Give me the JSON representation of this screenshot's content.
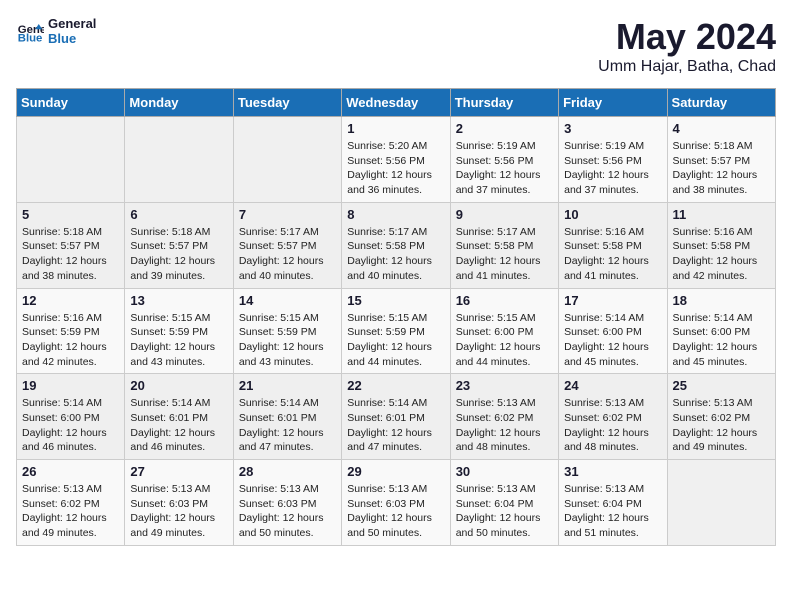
{
  "logo": {
    "text_general": "General",
    "text_blue": "Blue"
  },
  "title": "May 2024",
  "subtitle": "Umm Hajar, Batha, Chad",
  "weekdays": [
    "Sunday",
    "Monday",
    "Tuesday",
    "Wednesday",
    "Thursday",
    "Friday",
    "Saturday"
  ],
  "weeks": [
    [
      {
        "day": "",
        "sunrise": "",
        "sunset": "",
        "daylight": ""
      },
      {
        "day": "",
        "sunrise": "",
        "sunset": "",
        "daylight": ""
      },
      {
        "day": "",
        "sunrise": "",
        "sunset": "",
        "daylight": ""
      },
      {
        "day": "1",
        "sunrise": "Sunrise: 5:20 AM",
        "sunset": "Sunset: 5:56 PM",
        "daylight": "Daylight: 12 hours and 36 minutes."
      },
      {
        "day": "2",
        "sunrise": "Sunrise: 5:19 AM",
        "sunset": "Sunset: 5:56 PM",
        "daylight": "Daylight: 12 hours and 37 minutes."
      },
      {
        "day": "3",
        "sunrise": "Sunrise: 5:19 AM",
        "sunset": "Sunset: 5:56 PM",
        "daylight": "Daylight: 12 hours and 37 minutes."
      },
      {
        "day": "4",
        "sunrise": "Sunrise: 5:18 AM",
        "sunset": "Sunset: 5:57 PM",
        "daylight": "Daylight: 12 hours and 38 minutes."
      }
    ],
    [
      {
        "day": "5",
        "sunrise": "Sunrise: 5:18 AM",
        "sunset": "Sunset: 5:57 PM",
        "daylight": "Daylight: 12 hours and 38 minutes."
      },
      {
        "day": "6",
        "sunrise": "Sunrise: 5:18 AM",
        "sunset": "Sunset: 5:57 PM",
        "daylight": "Daylight: 12 hours and 39 minutes."
      },
      {
        "day": "7",
        "sunrise": "Sunrise: 5:17 AM",
        "sunset": "Sunset: 5:57 PM",
        "daylight": "Daylight: 12 hours and 40 minutes."
      },
      {
        "day": "8",
        "sunrise": "Sunrise: 5:17 AM",
        "sunset": "Sunset: 5:58 PM",
        "daylight": "Daylight: 12 hours and 40 minutes."
      },
      {
        "day": "9",
        "sunrise": "Sunrise: 5:17 AM",
        "sunset": "Sunset: 5:58 PM",
        "daylight": "Daylight: 12 hours and 41 minutes."
      },
      {
        "day": "10",
        "sunrise": "Sunrise: 5:16 AM",
        "sunset": "Sunset: 5:58 PM",
        "daylight": "Daylight: 12 hours and 41 minutes."
      },
      {
        "day": "11",
        "sunrise": "Sunrise: 5:16 AM",
        "sunset": "Sunset: 5:58 PM",
        "daylight": "Daylight: 12 hours and 42 minutes."
      }
    ],
    [
      {
        "day": "12",
        "sunrise": "Sunrise: 5:16 AM",
        "sunset": "Sunset: 5:59 PM",
        "daylight": "Daylight: 12 hours and 42 minutes."
      },
      {
        "day": "13",
        "sunrise": "Sunrise: 5:15 AM",
        "sunset": "Sunset: 5:59 PM",
        "daylight": "Daylight: 12 hours and 43 minutes."
      },
      {
        "day": "14",
        "sunrise": "Sunrise: 5:15 AM",
        "sunset": "Sunset: 5:59 PM",
        "daylight": "Daylight: 12 hours and 43 minutes."
      },
      {
        "day": "15",
        "sunrise": "Sunrise: 5:15 AM",
        "sunset": "Sunset: 5:59 PM",
        "daylight": "Daylight: 12 hours and 44 minutes."
      },
      {
        "day": "16",
        "sunrise": "Sunrise: 5:15 AM",
        "sunset": "Sunset: 6:00 PM",
        "daylight": "Daylight: 12 hours and 44 minutes."
      },
      {
        "day": "17",
        "sunrise": "Sunrise: 5:14 AM",
        "sunset": "Sunset: 6:00 PM",
        "daylight": "Daylight: 12 hours and 45 minutes."
      },
      {
        "day": "18",
        "sunrise": "Sunrise: 5:14 AM",
        "sunset": "Sunset: 6:00 PM",
        "daylight": "Daylight: 12 hours and 45 minutes."
      }
    ],
    [
      {
        "day": "19",
        "sunrise": "Sunrise: 5:14 AM",
        "sunset": "Sunset: 6:00 PM",
        "daylight": "Daylight: 12 hours and 46 minutes."
      },
      {
        "day": "20",
        "sunrise": "Sunrise: 5:14 AM",
        "sunset": "Sunset: 6:01 PM",
        "daylight": "Daylight: 12 hours and 46 minutes."
      },
      {
        "day": "21",
        "sunrise": "Sunrise: 5:14 AM",
        "sunset": "Sunset: 6:01 PM",
        "daylight": "Daylight: 12 hours and 47 minutes."
      },
      {
        "day": "22",
        "sunrise": "Sunrise: 5:14 AM",
        "sunset": "Sunset: 6:01 PM",
        "daylight": "Daylight: 12 hours and 47 minutes."
      },
      {
        "day": "23",
        "sunrise": "Sunrise: 5:13 AM",
        "sunset": "Sunset: 6:02 PM",
        "daylight": "Daylight: 12 hours and 48 minutes."
      },
      {
        "day": "24",
        "sunrise": "Sunrise: 5:13 AM",
        "sunset": "Sunset: 6:02 PM",
        "daylight": "Daylight: 12 hours and 48 minutes."
      },
      {
        "day": "25",
        "sunrise": "Sunrise: 5:13 AM",
        "sunset": "Sunset: 6:02 PM",
        "daylight": "Daylight: 12 hours and 49 minutes."
      }
    ],
    [
      {
        "day": "26",
        "sunrise": "Sunrise: 5:13 AM",
        "sunset": "Sunset: 6:02 PM",
        "daylight": "Daylight: 12 hours and 49 minutes."
      },
      {
        "day": "27",
        "sunrise": "Sunrise: 5:13 AM",
        "sunset": "Sunset: 6:03 PM",
        "daylight": "Daylight: 12 hours and 49 minutes."
      },
      {
        "day": "28",
        "sunrise": "Sunrise: 5:13 AM",
        "sunset": "Sunset: 6:03 PM",
        "daylight": "Daylight: 12 hours and 50 minutes."
      },
      {
        "day": "29",
        "sunrise": "Sunrise: 5:13 AM",
        "sunset": "Sunset: 6:03 PM",
        "daylight": "Daylight: 12 hours and 50 minutes."
      },
      {
        "day": "30",
        "sunrise": "Sunrise: 5:13 AM",
        "sunset": "Sunset: 6:04 PM",
        "daylight": "Daylight: 12 hours and 50 minutes."
      },
      {
        "day": "31",
        "sunrise": "Sunrise: 5:13 AM",
        "sunset": "Sunset: 6:04 PM",
        "daylight": "Daylight: 12 hours and 51 minutes."
      },
      {
        "day": "",
        "sunrise": "",
        "sunset": "",
        "daylight": ""
      }
    ]
  ]
}
